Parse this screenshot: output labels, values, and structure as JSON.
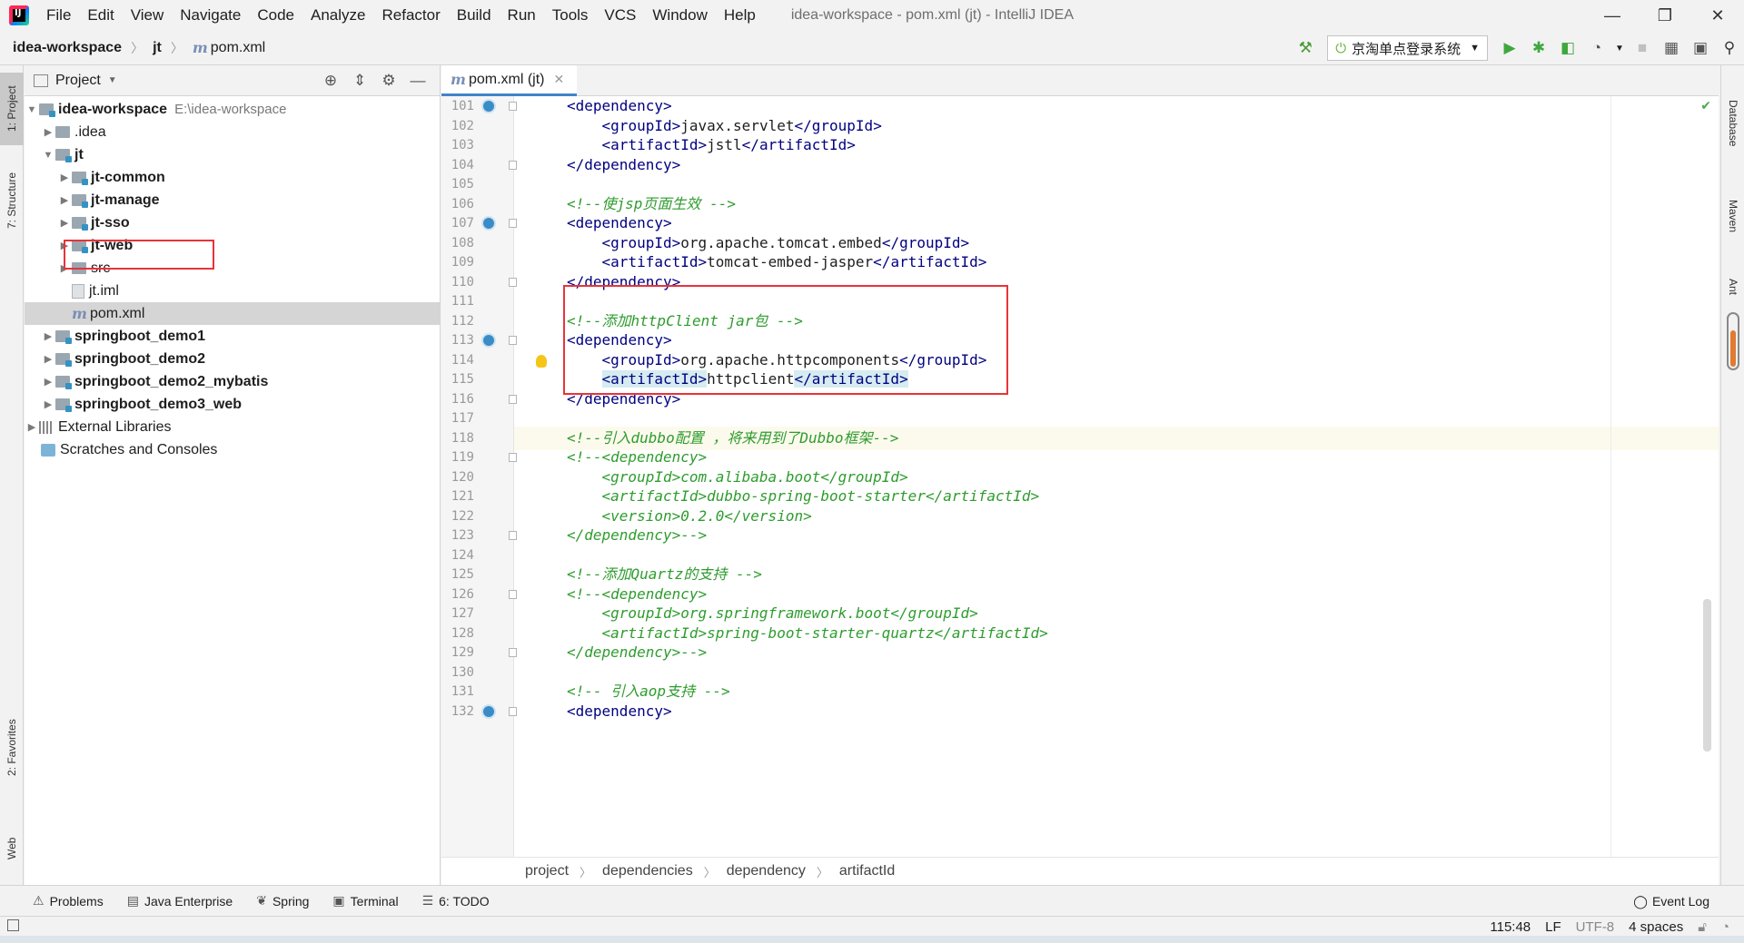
{
  "menubar": {
    "items": [
      "File",
      "Edit",
      "View",
      "Navigate",
      "Code",
      "Analyze",
      "Refactor",
      "Build",
      "Run",
      "Tools",
      "VCS",
      "Window",
      "Help"
    ],
    "window_title": "idea-workspace - pom.xml (jt) - IntelliJ IDEA",
    "app_icon_letters": "IJ"
  },
  "navbar": {
    "crumbs": [
      "idea-workspace",
      "jt",
      "pom.xml"
    ],
    "run_config": "京淘单点登录系统"
  },
  "left_strip": {
    "tabs": [
      "1: Project",
      "7: Structure",
      "2: Favorites",
      "Web"
    ]
  },
  "right_strip": {
    "tabs": [
      "Database",
      "Maven",
      "Ant"
    ]
  },
  "project_panel": {
    "title": "Project",
    "root_name": "idea-workspace",
    "root_path": "E:\\idea-workspace",
    "items": [
      {
        "label": "idea-workspace"
      },
      {
        "label": ".idea"
      },
      {
        "label": "jt"
      },
      {
        "label": "jt-common"
      },
      {
        "label": "jt-manage"
      },
      {
        "label": "jt-sso"
      },
      {
        "label": "jt-web"
      },
      {
        "label": "src"
      },
      {
        "label": "jt.iml"
      },
      {
        "label": "pom.xml"
      },
      {
        "label": "springboot_demo1"
      },
      {
        "label": "springboot_demo2"
      },
      {
        "label": "springboot_demo2_mybatis"
      },
      {
        "label": "springboot_demo3_web"
      },
      {
        "label": "External Libraries"
      },
      {
        "label": "Scratches and Consoles"
      }
    ]
  },
  "editor": {
    "tab_label": "pom.xml (jt)",
    "line_numbers": [
      "101",
      "102",
      "103",
      "104",
      "105",
      "106",
      "107",
      "108",
      "109",
      "110",
      "111",
      "112",
      "113",
      "114",
      "115",
      "116",
      "117",
      "118",
      "119",
      "120",
      "121",
      "122",
      "123",
      "124",
      "125",
      "126",
      "127",
      "128",
      "129",
      "130",
      "131",
      "132"
    ],
    "lines": [
      "<dependency>",
      "    <groupId>javax.servlet</groupId>",
      "    <artifactId>jstl</artifactId>",
      "</dependency>",
      "",
      "<!--使jsp页面生效 -->",
      "<dependency>",
      "    <groupId>org.apache.tomcat.embed</groupId>",
      "    <artifactId>tomcat-embed-jasper</artifactId>",
      "</dependency>",
      "",
      "<!--添加httpClient jar包 -->",
      "<dependency>",
      "    <groupId>org.apache.httpcomponents</groupId>",
      "    <artifactId>httpclient</artifactId>",
      "</dependency>",
      "",
      "<!--引入dubbo配置 ，将来用到了Dubbo框架-->",
      "<!--<dependency>",
      "    <groupId>com.alibaba.boot</groupId>",
      "    <artifactId>dubbo-spring-boot-starter</artifactId>",
      "    <version>0.2.0</version>",
      "</dependency>-->",
      "",
      "<!--添加Quartz的支持 -->",
      "<!--<dependency>",
      "    <groupId>org.springframework.boot</groupId>",
      "    <artifactId>spring-boot-starter-quartz</artifactId>",
      "</dependency>-->",
      "",
      "<!-- 引入aop支持 -->",
      "<dependency>"
    ],
    "breadcrumb": [
      "project",
      "dependencies",
      "dependency",
      "artifactId"
    ]
  },
  "bottom_tools": [
    "Problems",
    "Java Enterprise",
    "Spring",
    "Terminal",
    "6: TODO"
  ],
  "event_log": "Event Log",
  "status": {
    "position": "115:48",
    "line_sep": "LF",
    "encoding": "UTF-8",
    "indent": "4 spaces"
  }
}
